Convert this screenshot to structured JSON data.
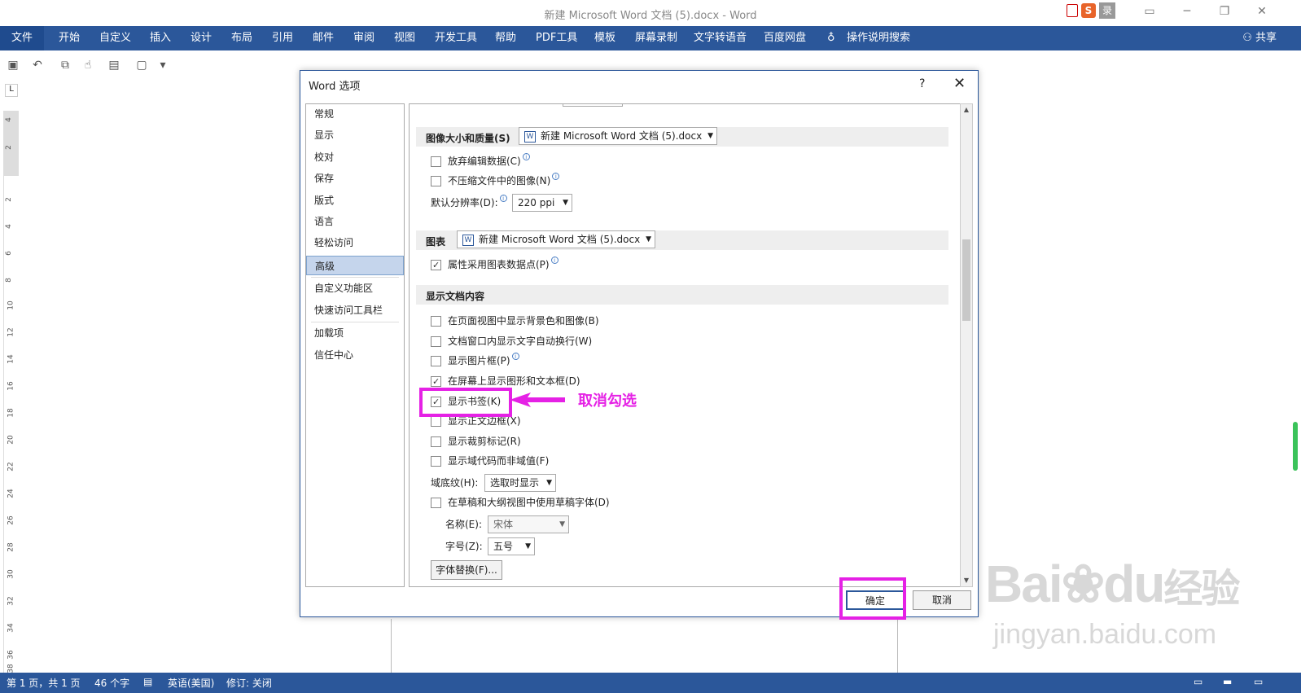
{
  "window": {
    "title": "新建 Microsoft Word 文档 (5).docx  -  Word",
    "ime_label": "录"
  },
  "ribbon": {
    "file": "文件",
    "tabs": [
      "开始",
      "自定义",
      "插入",
      "设计",
      "布局",
      "引用",
      "邮件",
      "审阅",
      "视图",
      "开发工具",
      "帮助",
      "PDF工具",
      "模板",
      "屏幕录制",
      "文字转语音",
      "百度网盘"
    ],
    "tell_me": "操作说明搜索",
    "share": "共享"
  },
  "ruler": {
    "marks": [
      "4",
      "2",
      "2",
      "4",
      "6",
      "8",
      "10",
      "12",
      "14",
      "16",
      "18",
      "20",
      "22",
      "24",
      "26",
      "28",
      "30",
      "32",
      "34",
      "36",
      "38"
    ]
  },
  "status": {
    "page": "第 1 页，共 1 页",
    "words": "46 个字",
    "lang": "英语(美国)",
    "track": "修订: 关闭"
  },
  "dialog": {
    "title": "Word 选项",
    "help": "?",
    "close": "✕",
    "nav": [
      "常规",
      "显示",
      "校对",
      "保存",
      "版式",
      "语言",
      "轻松访问",
      "高级",
      "自定义功能区",
      "快速访问工具栏",
      "加载项",
      "信任中心"
    ],
    "active_nav": "高级",
    "sec_image": "图像大小和质量(S)",
    "image_doc": "新建 Microsoft Word 文档 (5).docx",
    "discard_edit": "放弃编辑数据(C)",
    "no_compress": "不压缩文件中的图像(N)",
    "default_res_label": "默认分辨率(D):",
    "default_res": "220 ppi",
    "sec_chart": "图表",
    "chart_doc": "新建 Microsoft Word 文档 (5).docx",
    "chart_prop": "属性采用图表数据点(P)",
    "sec_display": "显示文档内容",
    "opt_bg": "在页面视图中显示背景色和图像(B)",
    "opt_wrap": "文档窗口内显示文字自动换行(W)",
    "opt_picframe": "显示图片框(P)",
    "opt_shapes": "在屏幕上显示图形和文本框(D)",
    "opt_bookmarks": "显示书签(K)",
    "opt_textbound": "显示正文边框(X)",
    "opt_crop": "显示裁剪标记(R)",
    "opt_fieldcodes": "显示域代码而非域值(F)",
    "field_shading_label": "域底纹(H):",
    "field_shading": "选取时显示",
    "opt_draftfont": "在草稿和大纲视图中使用草稿字体(D)",
    "name_label": "名称(E):",
    "name_value": "宋体",
    "size_label": "字号(Z):",
    "size_value": "五号",
    "font_sub": "字体替换(F)...",
    "ok": "确定",
    "cancel": "取消"
  },
  "annotation": {
    "text": "取消勾选",
    "color": "#e521e5"
  },
  "watermark": {
    "big": "Bai",
    "big2": "du",
    "cn": "经验",
    "url": "jingyan.baidu.com"
  },
  "colors": {
    "ribbon": "#2b579a",
    "highlight": "#e521e5"
  }
}
